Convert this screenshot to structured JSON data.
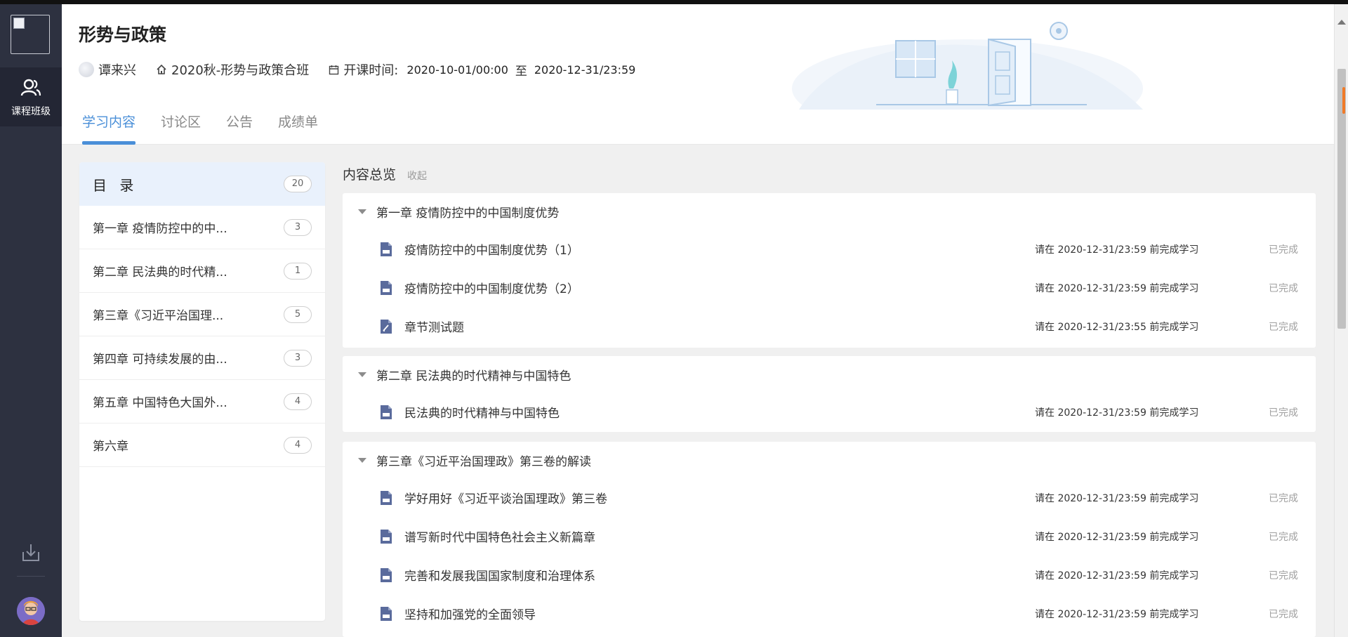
{
  "rail": {
    "nav_label": "课程班级"
  },
  "course": {
    "title": "形势与政策",
    "teacher": "谭来兴",
    "class_name": "2020秋-形势与政策合班",
    "time_label": "开课时间:",
    "start": "2020-10-01/00:00",
    "to": "至",
    "end": "2020-12-31/23:59"
  },
  "tabs": [
    {
      "label": "学习内容",
      "active": true
    },
    {
      "label": "讨论区",
      "active": false
    },
    {
      "label": "公告",
      "active": false
    },
    {
      "label": "成绩单",
      "active": false
    }
  ],
  "catalog": {
    "title": "目 录",
    "total": "20",
    "items": [
      {
        "label": "第一章 疫情防控中的中...",
        "count": "3"
      },
      {
        "label": "第二章 民法典的时代精...",
        "count": "1"
      },
      {
        "label": "第三章《习近平治国理...",
        "count": "5"
      },
      {
        "label": "第四章 可持续发展的由...",
        "count": "3"
      },
      {
        "label": "第五章 中国特色大国外...",
        "count": "4"
      },
      {
        "label": "第六章",
        "count": "4"
      }
    ]
  },
  "overview": {
    "title": "内容总览",
    "collapse": "收起",
    "chapters": [
      {
        "title": "第一章 疫情防控中的中国制度优势",
        "lessons": [
          {
            "name": "疫情防控中的中国制度优势（1）",
            "icon": "document-icon",
            "due": "请在 2020-12-31/23:59 前完成学习",
            "state": "已完成"
          },
          {
            "name": "疫情防控中的中国制度优势（2）",
            "icon": "document-icon",
            "due": "请在 2020-12-31/23:59 前完成学习",
            "state": "已完成"
          },
          {
            "name": "章节测试题",
            "icon": "quiz-icon",
            "due": "请在 2020-12-31/23:55 前完成学习",
            "state": "已完成"
          }
        ]
      },
      {
        "title": "第二章 民法典的时代精神与中国特色",
        "lessons": [
          {
            "name": "民法典的时代精神与中国特色",
            "icon": "document-icon",
            "due": "请在 2020-12-31/23:59 前完成学习",
            "state": "已完成"
          }
        ]
      },
      {
        "title": "第三章《习近平治国理政》第三卷的解读",
        "lessons": [
          {
            "name": "学好用好《习近平谈治国理政》第三卷",
            "icon": "document-icon",
            "due": "请在 2020-12-31/23:59 前完成学习",
            "state": "已完成"
          },
          {
            "name": "谱写新时代中国特色社会主义新篇章",
            "icon": "document-icon",
            "due": "请在 2020-12-31/23:59 前完成学习",
            "state": "已完成"
          },
          {
            "name": "完善和发展我国国家制度和治理体系",
            "icon": "document-icon",
            "due": "请在 2020-12-31/23:59 前完成学习",
            "state": "已完成"
          },
          {
            "name": "坚持和加强党的全面领导",
            "icon": "document-icon",
            "due": "请在 2020-12-31/23:59 前完成学习",
            "state": "已完成"
          }
        ]
      }
    ]
  },
  "colors": {
    "accent": "#4a8fd8",
    "rail_bg": "#2d3140",
    "icon_doc": "#5a6b9c"
  }
}
